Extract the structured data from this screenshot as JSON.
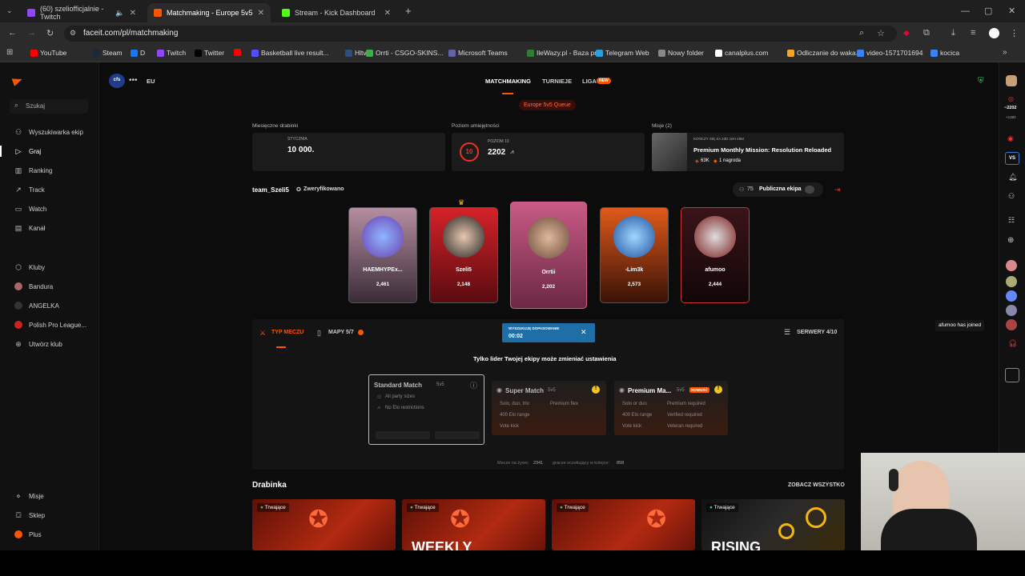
{
  "browser": {
    "tabs": [
      {
        "title": "(60) szeliofficjalnie - Twitch",
        "color": "#9146ff",
        "active": false
      },
      {
        "title": "Matchmaking - Europe 5v5 Qu",
        "color": "#ff5500",
        "active": true
      },
      {
        "title": "Stream - Kick Dashboard",
        "color": "#53fc18",
        "active": false
      }
    ],
    "url": "faceit.com/pl/matchmaking",
    "bookmarks": [
      {
        "label": "YouTube",
        "color": "#ff0000"
      },
      {
        "label": "Steam",
        "color": "#1b2838"
      },
      {
        "label": "D",
        "color": "#1877f2"
      },
      {
        "label": "Twitch",
        "color": "#9146ff"
      },
      {
        "label": "Twitter",
        "color": "#000000"
      },
      {
        "label": "",
        "color": "#ff0000"
      },
      {
        "label": "Basketball live result...",
        "color": "#5050ff"
      },
      {
        "label": "Hltv",
        "color": "#2d4f7c"
      },
      {
        "label": "Orrti - CSGO-SKINS...",
        "color": "#3cb043"
      },
      {
        "label": "Microsoft Teams",
        "color": "#6264a7"
      },
      {
        "label": "IleWazy.pl - Baza pr...",
        "color": "#2e7d32"
      },
      {
        "label": "Telegram Web",
        "color": "#2aa1da"
      },
      {
        "label": "Nowy folder",
        "color": "#888888"
      },
      {
        "label": "canalplus.com",
        "color": "#ffffff"
      },
      {
        "label": "Odliczanie do waka...",
        "color": "#f5a623"
      },
      {
        "label": "video-1571701694",
        "color": "#3b82f6"
      },
      {
        "label": "kocica",
        "color": "#3b82f6"
      }
    ]
  },
  "sidebar": {
    "search_placeholder": "Szukaj",
    "items": [
      {
        "label": "Wyszukiwarka ekip",
        "icon": "users-icon"
      },
      {
        "label": "Graj",
        "icon": "play-icon"
      },
      {
        "label": "Ranking",
        "icon": "ranking-icon"
      },
      {
        "label": "Track",
        "icon": "track-icon"
      },
      {
        "label": "Watch",
        "icon": "watch-icon"
      },
      {
        "label": "Kanał",
        "icon": "channel-icon"
      }
    ],
    "clubs": [
      {
        "label": "Kluby"
      },
      {
        "label": "Bandura"
      },
      {
        "label": "ANGELKA"
      },
      {
        "label": "Polish Pro League..."
      },
      {
        "label": "Utwórz klub"
      }
    ],
    "bottom": [
      {
        "label": "Misje"
      },
      {
        "label": "Sklep"
      },
      {
        "label": "Plus"
      }
    ]
  },
  "header": {
    "brand": "cfs",
    "region": "EU",
    "nav": [
      "MATCHMAKING",
      "TURNIEJE",
      "LIGA"
    ],
    "liga_badge": "NEW",
    "queue_badge": "Europe 5v5 Queue"
  },
  "stats": {
    "monthly": {
      "label": "Miesięczne drabinki",
      "sub": "STYCZNIA",
      "value": "10 000."
    },
    "skill": {
      "label": "Poziom umiejętności",
      "sub": "POZIOM 10",
      "level": "10",
      "value": "2202"
    },
    "missions": {
      "label": "Misje (2)",
      "sub": "KOŃCZY SIĘ ZA 23D 18H 49M",
      "title": "Premium Monthly Mission: Resolution Reloaded",
      "points": "63K",
      "reward": "1 nagroda"
    }
  },
  "team": {
    "name": "team_Szeli5",
    "verified": "Zweryfikowano",
    "count": "75",
    "public_label": "Publiczna ekipa",
    "players": [
      {
        "name": "HAEMHYPEx...",
        "elo": "2,461"
      },
      {
        "name": "Szeli5",
        "elo": "2,148"
      },
      {
        "name": "Orrtii",
        "elo": "2,202"
      },
      {
        "name": "-Lim3k",
        "elo": "2,573"
      },
      {
        "name": "afumoo",
        "elo": "2,444"
      }
    ]
  },
  "matchbar": {
    "type_tab": "TYP MECZU",
    "maps_tab": "MAPY 5/7",
    "search_title": "WYSZUKUJĘ DOPASOWANIE",
    "search_timer": "00:02",
    "servers": "SERWERY 4/10",
    "notice": "Tylko lider Twojej ekipy może zmieniać ustawienia"
  },
  "modes": [
    {
      "title": "Standard Match",
      "tag": "5v5",
      "features": [
        "All party sizes",
        "No Elo restrictions"
      ],
      "badge": ""
    },
    {
      "title": "Super Match",
      "tag": "5v5",
      "features": [
        "Solo, duo, trio",
        "Premium flex",
        "400 Elo range",
        "Vote kick"
      ],
      "badge": ""
    },
    {
      "title": "Premium Ma...",
      "tag": "5v5",
      "features": [
        "Solo or duo",
        "Premium required",
        "400 Elo range",
        "Verified required",
        "Vote kick",
        "Veteran required"
      ],
      "badge": "NOWOŚĆ"
    }
  ],
  "queue_stats": {
    "live_label": "Mecze na żywo:",
    "live": "2341",
    "waiting_label": "gracze oczekujący w kolejce:",
    "waiting": "858"
  },
  "bracket": {
    "title": "Drabinka",
    "see_all": "ZOBACZ WSZYSTKO",
    "cards": [
      {
        "status": "Trwające",
        "text": ""
      },
      {
        "status": "Trwające",
        "text": "WEEKLY"
      },
      {
        "status": "Trwające",
        "text": ""
      },
      {
        "status": "Trwające",
        "text": "RISING"
      }
    ]
  },
  "notification": "afumoo has joined",
  "right_strip": {
    "elo_top": "~2202",
    "elo_sub": "+1384",
    "vs_badge": "VS"
  },
  "colors": {
    "accent": "#ff5500",
    "search_blue": "#1e6fa8",
    "bg": "#0c0c0c"
  }
}
